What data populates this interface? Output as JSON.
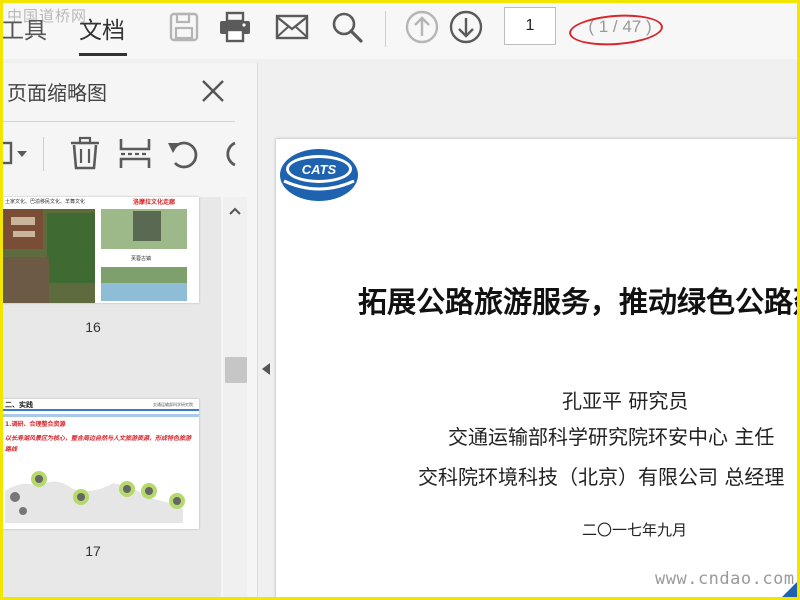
{
  "watermark": {
    "top": "中国道桥网",
    "bottom": "www.cndao.com"
  },
  "menu": {
    "tools_label": "工具",
    "doc_label": "文档"
  },
  "toolbar": {
    "icons": [
      "save-icon",
      "print-icon",
      "email-icon",
      "search-icon",
      "page-up-icon",
      "page-down-icon"
    ],
    "page_input_value": "1",
    "page_count": "( 1 / 47 )",
    "highlight_color": "#d8262c"
  },
  "sidebar": {
    "title": "页面缩略图",
    "tools": [
      "options-dropdown-icon",
      "delete-icon",
      "extract-icon",
      "rotate-left-icon",
      "rotate-right-icon"
    ],
    "thumbnails": [
      {
        "page_label": "16",
        "caption_left": "土家文化、巴渝移民文化、羊舞文化",
        "caption_red": "洛摩拉文化走廊",
        "caption_small": "芙蓉古镇"
      },
      {
        "page_label": "17",
        "heading": "二、实践",
        "subheading": "1.调研、合理整合资源",
        "red_text": "以长寿湖风景区为核心，整合周边自然与人文旅游资源，形成特色旅游路线",
        "logo_text": "交通运输部科学研究院"
      }
    ]
  },
  "document": {
    "title": "拓展公路旅游服务，推动绿色公路建设",
    "author": "孔亚平    研究员",
    "org1": "交通运输部科学研究院环安中心    主任",
    "org2": "交科院环境科技（北京）有限公司    总经理",
    "date": "二〇一七年九月",
    "logo_text": "CATS",
    "brand_color": "#1f63b0"
  }
}
